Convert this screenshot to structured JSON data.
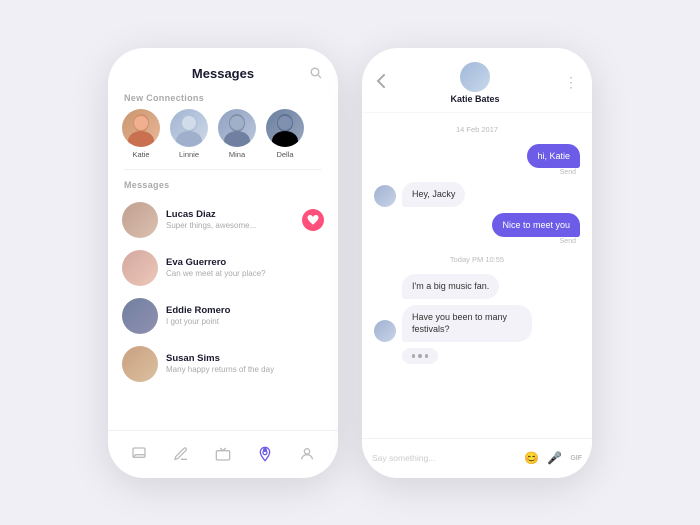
{
  "left_phone": {
    "header": {
      "title": "Messages",
      "search_icon": "🔍"
    },
    "new_connections_label": "New Connections",
    "connections": [
      {
        "name": "Katie",
        "class": "av-katie"
      },
      {
        "name": "Linnie",
        "class": "av-linnie"
      },
      {
        "name": "Mina",
        "class": "av-mina"
      },
      {
        "name": "Della",
        "class": "av-della"
      }
    ],
    "messages_label": "Messages",
    "messages": [
      {
        "name": "Lucas Diaz",
        "preview": "Super things, awesome...",
        "avatar_class": "msg-av-lucas",
        "has_badge": true
      },
      {
        "name": "Eva Guerrero",
        "preview": "Can we meet at your place?",
        "avatar_class": "msg-av-eva",
        "has_badge": false
      },
      {
        "name": "Eddie Romero",
        "preview": "I got your point",
        "avatar_class": "msg-av-eddie",
        "has_badge": false
      },
      {
        "name": "Susan Sims",
        "preview": "Many happy returns of the day",
        "avatar_class": "msg-av-susan",
        "has_badge": false
      }
    ],
    "nav_items": [
      {
        "icon": "💬",
        "active": false
      },
      {
        "icon": "✏️",
        "active": false
      },
      {
        "icon": "📺",
        "active": false
      },
      {
        "icon": "📍",
        "active": true
      },
      {
        "icon": "👤",
        "active": false
      }
    ]
  },
  "right_phone": {
    "back_icon": "‹",
    "more_icon": "⋮",
    "contact_name": "Katie Bates",
    "date_label": "14 Feb 2017",
    "time_label": "Today PM 10:55",
    "messages": [
      {
        "text": "hi, Katie",
        "type": "outgoing"
      },
      {
        "text": "Hey, Jacky",
        "type": "incoming"
      },
      {
        "text": "Nice to meet you",
        "type": "outgoing"
      },
      {
        "text": "I'm a big music fan.",
        "type": "incoming"
      },
      {
        "text": "Have you been to many festivals?",
        "type": "incoming"
      },
      {
        "text": "typing",
        "type": "typing"
      }
    ],
    "send_label": "Send",
    "input_placeholder": "Say something...",
    "emoji_icon": "😊",
    "mic_icon": "🎤",
    "gif_label": "GIF"
  }
}
